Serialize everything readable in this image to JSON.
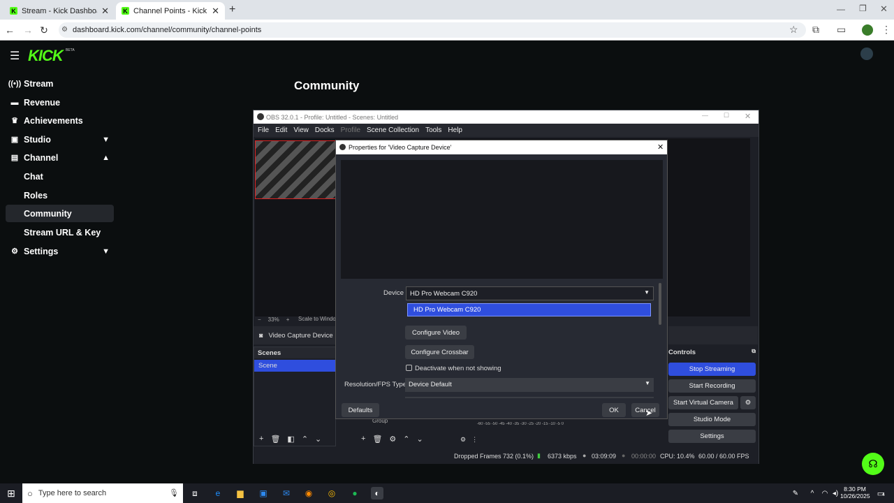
{
  "browser": {
    "tabs": [
      {
        "label": "Stream - Kick Dashboard",
        "active": false
      },
      {
        "label": "Channel Points - Kick Dashboard",
        "active": true
      }
    ],
    "url": "dashboard.kick.com/channel/community/channel-points"
  },
  "kick": {
    "logo": "KICK",
    "logo_badge": "BETA",
    "page_title": "Community",
    "sidebar": [
      {
        "label": "Stream",
        "icon": "broadcast-icon",
        "sub": false
      },
      {
        "label": "Revenue",
        "icon": "money-icon",
        "sub": false
      },
      {
        "label": "Achievements",
        "icon": "trophy-icon",
        "sub": false
      },
      {
        "label": "Studio",
        "icon": "clapper-icon",
        "sub": false,
        "chevron": "down"
      },
      {
        "label": "Channel",
        "icon": "channel-icon",
        "sub": false,
        "chevron": "up"
      },
      {
        "label": "Chat",
        "sub": true
      },
      {
        "label": "Roles",
        "sub": true
      },
      {
        "label": "Community",
        "sub": true,
        "active": true
      },
      {
        "label": "Stream URL & Key",
        "sub": true
      },
      {
        "label": "Settings",
        "icon": "gear-icon",
        "sub": false,
        "chevron": "down"
      }
    ]
  },
  "obs": {
    "title": "OBS 32.0.1 - Profile: Untitled - Scenes: Untitled",
    "menu": [
      "File",
      "Edit",
      "View",
      "Docks",
      "Profile",
      "Scene Collection",
      "Tools",
      "Help"
    ],
    "zoom": "33%",
    "scale_label": "Scale to Window",
    "source_name": "Video Capture Device",
    "scenes_header": "Scenes",
    "scene_item": "Scene",
    "group_item": "Group",
    "controls_header": "Controls",
    "controls": [
      "Stop Streaming",
      "Start Recording",
      "Start Virtual Camera",
      "Studio Mode",
      "Settings"
    ],
    "meter_ticks": "-60 -55 -50 -45 -40 -35 -30 -25 -20 -15 -10 -5 0",
    "status": {
      "dropped": "Dropped Frames 732 (0.1%)",
      "bitrate": "6373 kbps",
      "stream_time": "03:09:09",
      "rec_time": "00:00:00",
      "cpu": "CPU: 10.4%",
      "fps": "60.00 / 60.00 FPS"
    }
  },
  "dialog": {
    "title": "Properties for 'Video Capture Device'",
    "device_label": "Device",
    "device_value": "HD Pro Webcam C920",
    "dropdown_option": "HD Pro Webcam C920",
    "configure_video": "Configure Video",
    "configure_crossbar": "Configure Crossbar",
    "deactivate_label": "Deactivate when not showing",
    "resfps_label": "Resolution/FPS Type",
    "resfps_value": "Device Default",
    "defaults": "Defaults",
    "ok": "OK",
    "cancel": "Cancel"
  },
  "taskbar": {
    "search_placeholder": "Type here to search",
    "time": "8:30 PM",
    "date": "10/26/2025",
    "notif_count": "4"
  },
  "colors": {
    "kick_green": "#53fc18",
    "obs_blue": "#2f4ede"
  }
}
